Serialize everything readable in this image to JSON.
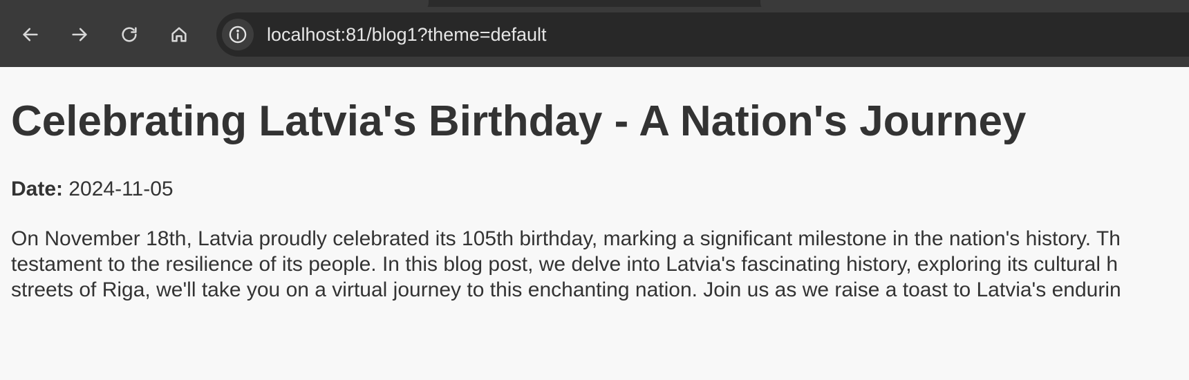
{
  "browser": {
    "url": "localhost:81/blog1?theme=default",
    "icons": {
      "back": "arrow-left-icon",
      "forward": "arrow-right-icon",
      "reload": "reload-icon",
      "home": "home-icon",
      "site_info": "info-icon"
    }
  },
  "article": {
    "title": "Celebrating Latvia's Birthday - A Nation's Journey",
    "date_label": "Date:",
    "date_value": "2024-11-05",
    "body_lines": [
      "On November 18th, Latvia proudly celebrated its 105th birthday, marking a significant milestone in the nation's history. Th",
      "testament to the resilience of its people. In this blog post, we delve into Latvia's fascinating history, exploring its cultural h",
      "streets of Riga, we'll take you on a virtual journey to this enchanting nation. Join us as we raise a toast to Latvia's endurin"
    ]
  },
  "colors": {
    "chrome_bg": "#3a3a3a",
    "omnibox_bg": "#282828",
    "page_bg": "#f8f8f8",
    "text": "#333333"
  }
}
